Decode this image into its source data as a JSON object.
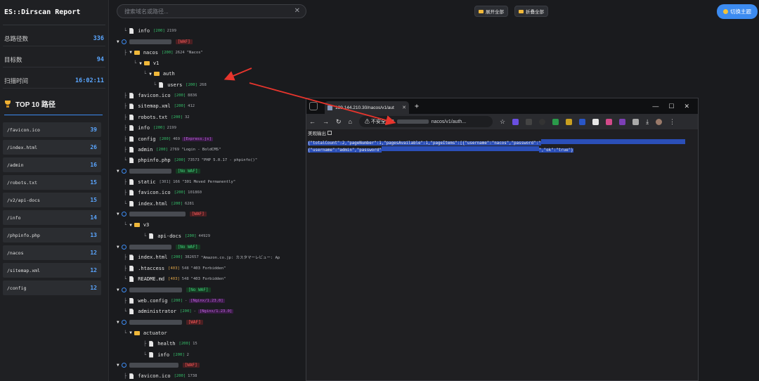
{
  "app": {
    "title": "ES::Dirscan Report"
  },
  "stats": [
    {
      "label": "总路径数",
      "value": "336"
    },
    {
      "label": "目标数",
      "value": "94"
    },
    {
      "label": "扫描时间",
      "value": "16:02:11"
    }
  ],
  "top10": {
    "title": "TOP 10 路径",
    "items": [
      {
        "path": "/favicon.ico",
        "count": "39"
      },
      {
        "path": "/index.html",
        "count": "26"
      },
      {
        "path": "/admin",
        "count": "16"
      },
      {
        "path": "/robots.txt",
        "count": "15"
      },
      {
        "path": "/v2/api-docs",
        "count": "15"
      },
      {
        "path": "/info",
        "count": "14"
      },
      {
        "path": "/phpinfo.php",
        "count": "13"
      },
      {
        "path": "/nacos",
        "count": "12"
      },
      {
        "path": "/sitemap.xml",
        "count": "12"
      },
      {
        "path": "/config",
        "count": "12"
      }
    ]
  },
  "toolbar": {
    "search_placeholder": "搜索域名或路径...",
    "search_clear": "✕",
    "expand_all": "展开全部",
    "collapse_all": "折叠全部",
    "theme": "切换主题"
  },
  "tree": [
    {
      "conn": "└",
      "icon": "file",
      "name": "info",
      "status": "[200]",
      "size": "2199"
    },
    {
      "caret": "▼",
      "icon": "globe",
      "blur": 60,
      "waf": "[WAF]"
    },
    {
      "conn": "├",
      "caret": "▼",
      "icon": "folder",
      "name": "nacos",
      "status": "[200]",
      "size": "2624",
      "title": "\"Nacos\""
    },
    {
      "conn": "└",
      "caret": "▼",
      "icon": "folder",
      "name": "v1"
    },
    {
      "conn": "└",
      "caret": "▼",
      "icon": "folder",
      "name": "auth"
    },
    {
      "conn": "└",
      "icon": "file",
      "name": "users",
      "status": "[200]",
      "size": "268"
    },
    {
      "conn": "├",
      "icon": "file",
      "name": "favicon.ico",
      "status": "[200]",
      "size": "8836"
    },
    {
      "conn": "├",
      "icon": "file",
      "name": "sitemap.xml",
      "status": "[200]",
      "size": "412"
    },
    {
      "conn": "├",
      "icon": "file",
      "name": "robots.txt",
      "status": "[200]",
      "size": "32"
    },
    {
      "conn": "├",
      "icon": "file",
      "name": "info",
      "status": "[200]",
      "size": "2199"
    },
    {
      "conn": "├",
      "icon": "file",
      "name": "config",
      "status": "[200]",
      "size": "469",
      "tech": "[Express.js]"
    },
    {
      "conn": "├",
      "icon": "file",
      "name": "admin",
      "status": "[200]",
      "size": "2769",
      "title": "\"Login - BoldCMS\""
    },
    {
      "conn": "└",
      "icon": "file",
      "name": "phpinfo.php",
      "status": "[200]",
      "size": "73573",
      "title": "\"PHP 5.0.17 - phpinfo()\""
    },
    {
      "caret": "▼",
      "icon": "globe",
      "blur": 60,
      "nowaf": "[No WAF]"
    },
    {
      "conn": "├",
      "icon": "file",
      "name": "static",
      "status": "[301]",
      "size": "166",
      "title": "\"301 Moved Permanently\""
    },
    {
      "conn": "├",
      "icon": "file",
      "name": "favicon.ico",
      "status": "[200]",
      "size": "101860"
    },
    {
      "conn": "└",
      "icon": "file",
      "name": "index.html",
      "status": "[200]",
      "size": "6281"
    },
    {
      "caret": "▼",
      "icon": "globe",
      "blur": 80,
      "waf": "[WAF]"
    },
    {
      "conn": "└",
      "caret": "▼",
      "icon": "folder",
      "name": "v3"
    },
    {
      "conn": "└",
      "icon": "file",
      "name": "api-docs",
      "status": "[200]",
      "size": "44929"
    },
    {
      "caret": "▼",
      "icon": "globe",
      "blur": 60,
      "nowaf": "[No WAF]"
    },
    {
      "conn": "├",
      "icon": "file",
      "name": "index.html",
      "status": "[200]",
      "size": "382657",
      "title": "\"Amazon.co.jp: カスタマーレビュー: Ap"
    },
    {
      "conn": "├",
      "icon": "file",
      "name": ".htaccess",
      "status": "[403]",
      "size": "548",
      "title": "\"403 Forbidden\""
    },
    {
      "conn": "└",
      "icon": "file",
      "name": "README.md",
      "status": "[403]",
      "size": "548",
      "title": "\"403 Forbidden\""
    },
    {
      "caret": "▼",
      "icon": "globe",
      "blur": 75,
      "nowaf": "[No WAF]"
    },
    {
      "conn": "├",
      "icon": "file",
      "name": "web.config",
      "status": "[200]",
      "size": "-",
      "tech": "[Nginx/1.23.0]"
    },
    {
      "conn": "└",
      "icon": "file",
      "name": "administrator",
      "status": "[200]",
      "size": "-",
      "tech": "[Nginx/1.23.0]"
    },
    {
      "caret": "▼",
      "icon": "globe",
      "blur": 75,
      "waf": "[WAF]"
    },
    {
      "conn": "└",
      "caret": "▼",
      "icon": "folder",
      "name": "actuator"
    },
    {
      "conn": "├",
      "icon": "file",
      "name": "health",
      "status": "[200]",
      "size": "15"
    },
    {
      "conn": "└",
      "icon": "file",
      "name": "info",
      "status": "[200]",
      "size": "2"
    },
    {
      "caret": "▼",
      "icon": "globe",
      "blur": 70,
      "waf": "[WAF]"
    },
    {
      "conn": "├",
      "icon": "file",
      "name": "favicon.ico",
      "status": "[200]",
      "size": "1738"
    }
  ],
  "browser": {
    "tab_title": "139.144.210.30/nacos/v1/aut",
    "new_tab": "+",
    "controls": [
      "—",
      "☐",
      "✕"
    ],
    "address_warning": "⚠ 不安全",
    "address_prefix": "13",
    "address_suffix": "nacos/v1/auth...",
    "pretty_print": "美观输出",
    "json_line1": "{\"totalCount\":2,\"pageNumber\":1,\"pagesAvailable\":1,\"pageItems\":[{\"username\":\"nacos\",\"password\":\"",
    "json_line2": "{\"username\":\"admin\",\"password\"",
    "json_line2_end": "\",\"ok\":\"true\"}"
  },
  "colors": {
    "accent": "#3c8bf0",
    "waf": "#ff5a5a",
    "nowaf": "#3fd07a",
    "status200": "#34c26a",
    "arrow": "#e8352d"
  }
}
